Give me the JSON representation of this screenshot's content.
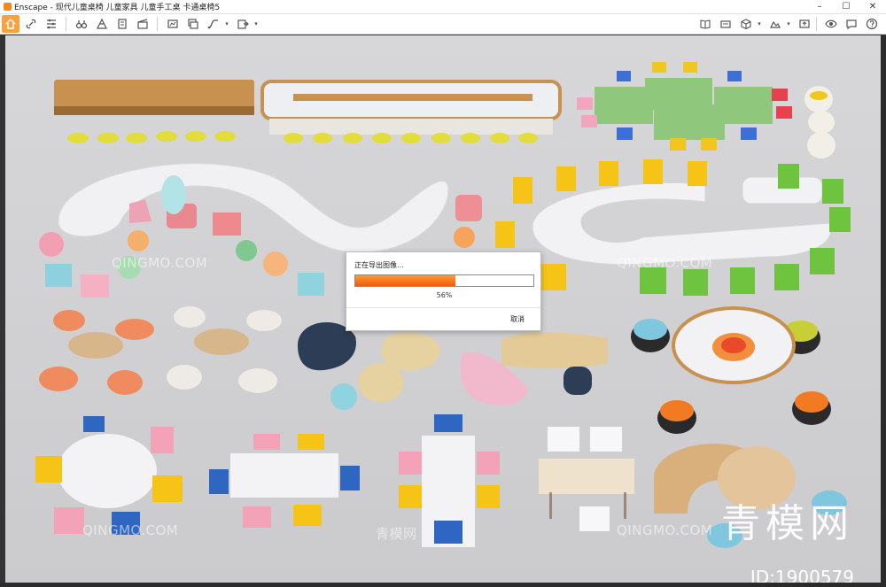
{
  "window": {
    "title": "Enscape - 现代儿童桌椅 儿童家具 儿童手工桌 卡通桌椅5",
    "minimize": "–",
    "maximize": "☐",
    "close": "✕"
  },
  "toolbar": {
    "left_icons": [
      "home-icon",
      "link-icon",
      "settings-list-icon",
      "binoculars-icon",
      "perspective-icon",
      "building-icon",
      "video-icon",
      "screenshot-icon",
      "batch-render-icon",
      "path-icon",
      "export-icon"
    ],
    "right_icons": [
      "book-icon",
      "panorama-icon",
      "cube-icon",
      "asset-icon",
      "upload-icon",
      "visibility-icon",
      "feedback-icon",
      "help-icon"
    ]
  },
  "export_dialog": {
    "message": "正在导出图像…",
    "progress_percent": 56,
    "progress_label": "56%",
    "cancel_label": "取消"
  },
  "watermarks": {
    "small_latin": "QINGMO.COM",
    "small_chinese": "青模网",
    "large": "青模网",
    "id_label": "ID:1900579"
  },
  "colors": {
    "accent_orange": "#f7a23a",
    "progress_start": "#ff9a30",
    "progress_end": "#ef5a0d"
  }
}
